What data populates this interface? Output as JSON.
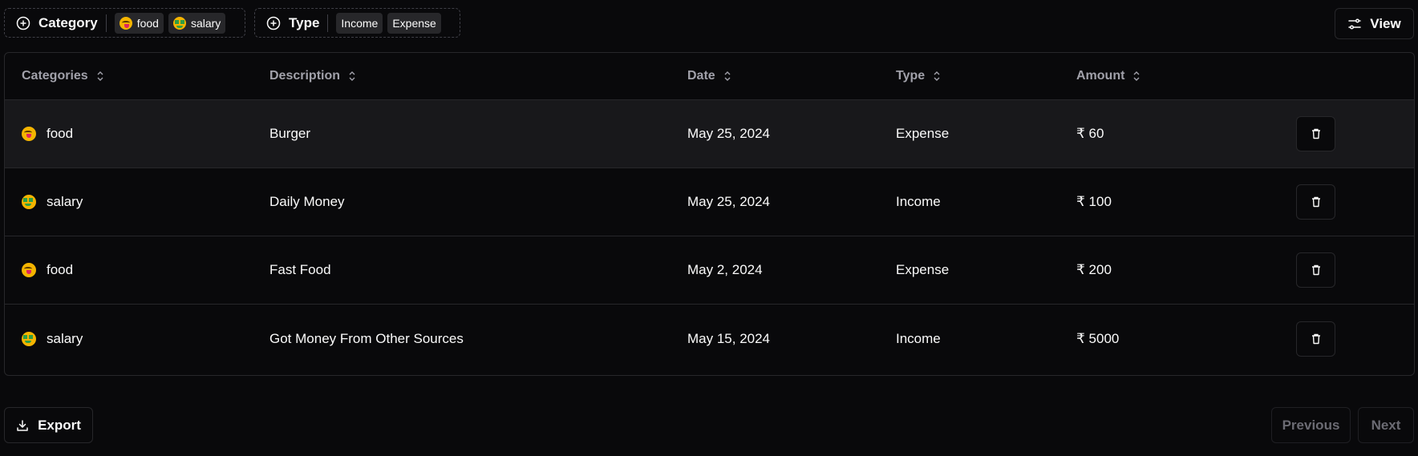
{
  "filters": {
    "category": {
      "label": "Category",
      "chips": [
        {
          "label": "food",
          "icon": "face-savoring-food-emoji"
        },
        {
          "label": "salary",
          "icon": "money-mouth-face-emoji"
        }
      ]
    },
    "type": {
      "label": "Type",
      "chips": [
        {
          "label": "Income"
        },
        {
          "label": "Expense"
        }
      ]
    }
  },
  "view_label": "View",
  "table": {
    "headers": [
      "Categories",
      "Description",
      "Date",
      "Type",
      "Amount"
    ],
    "rows": [
      {
        "category": "food",
        "icon": "face-savoring-food-emoji",
        "description": "Burger",
        "date": "May 25, 2024",
        "type": "Expense",
        "amount": "₹ 60"
      },
      {
        "category": "salary",
        "icon": "money-mouth-face-emoji",
        "description": "Daily Money",
        "date": "May 25, 2024",
        "type": "Income",
        "amount": "₹ 100"
      },
      {
        "category": "food",
        "icon": "face-savoring-food-emoji",
        "description": "Fast Food",
        "date": "May 2, 2024",
        "type": "Expense",
        "amount": "₹ 200"
      },
      {
        "category": "salary",
        "icon": "money-mouth-face-emoji",
        "description": "Got Money From Other Sources",
        "date": "May 15, 2024",
        "type": "Income",
        "amount": "₹ 5000"
      }
    ]
  },
  "footer": {
    "export_label": "Export",
    "previous_label": "Previous",
    "next_label": "Next"
  },
  "colors": {
    "background": "#09090b",
    "border": "#27272a",
    "header_text": "#a1a1aa",
    "highlight_row": "#18181b"
  }
}
